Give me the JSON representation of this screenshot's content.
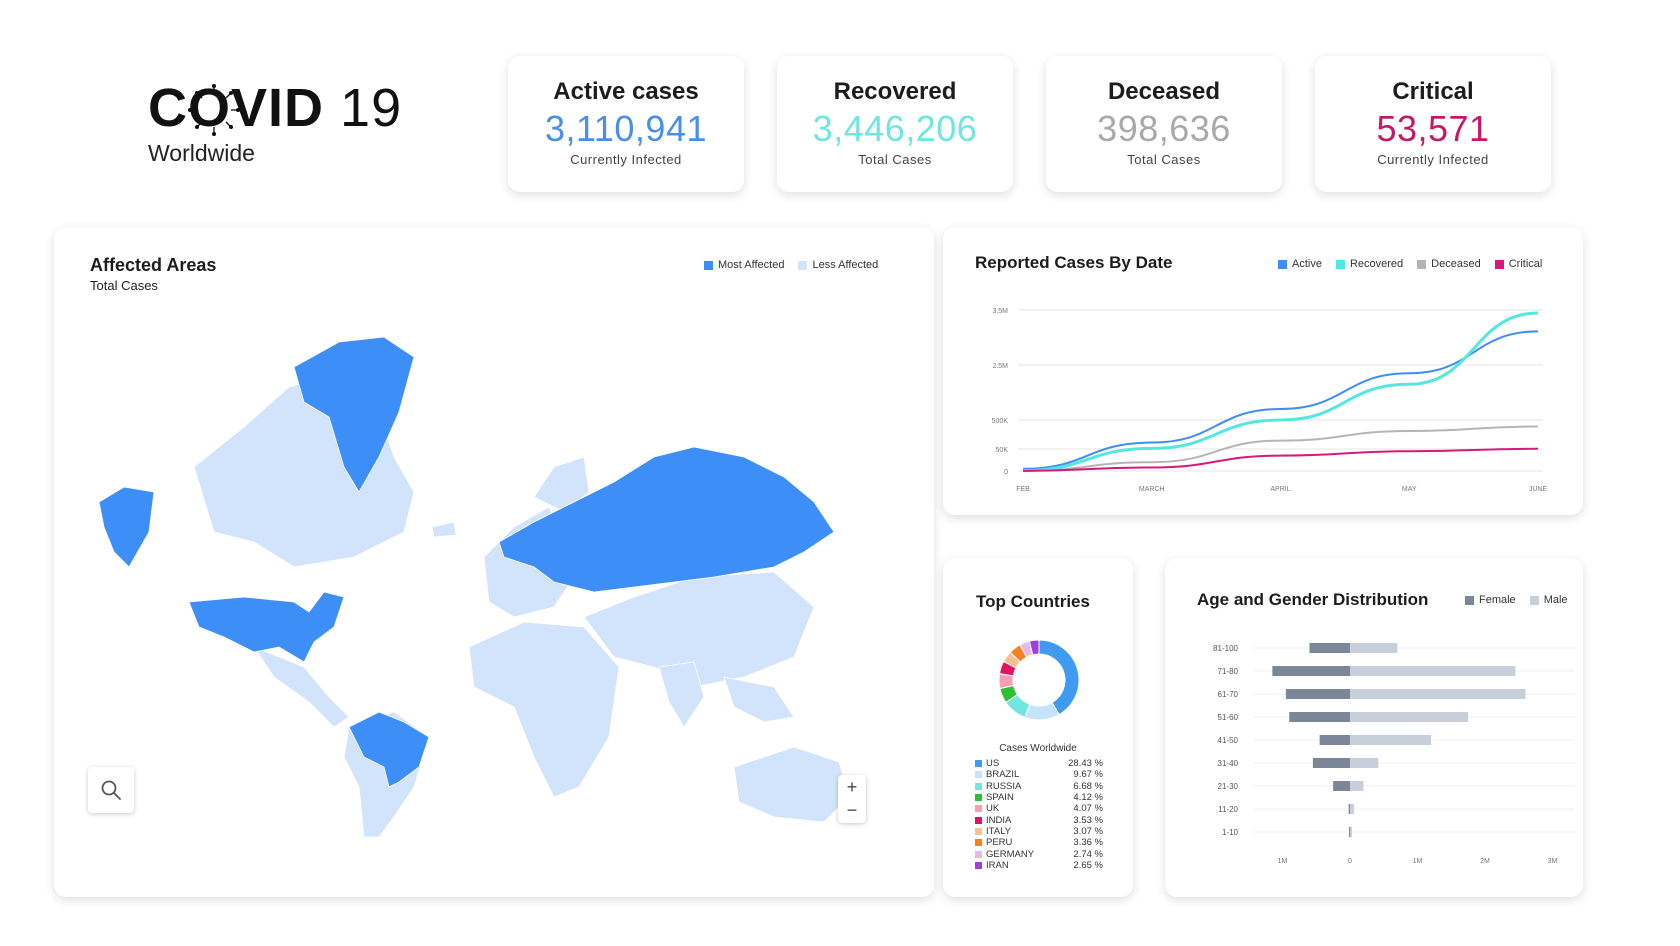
{
  "brand": {
    "title": "COVID",
    "title_num": "19",
    "subtitle": "Worldwide"
  },
  "stats": [
    {
      "label": "Active cases",
      "value": "3,110,941",
      "sub": "Currently Infected",
      "color": "#4a8fe7"
    },
    {
      "label": "Recovered",
      "value": "3,446,206",
      "sub": "Total Cases",
      "color": "#6fe6e0"
    },
    {
      "label": "Deceased",
      "value": "398,636",
      "sub": "Total Cases",
      "color": "#a9a9a9"
    },
    {
      "label": "Critical",
      "value": "53,571",
      "sub": "Currently Infected",
      "color": "#c2196b"
    }
  ],
  "affected_areas": {
    "title": "Affected Areas",
    "subtitle": "Total Cases",
    "legend": [
      {
        "label": "Most Affected",
        "color": "#3e8ef7"
      },
      {
        "label": "Less Affected",
        "color": "#d2e3fc"
      }
    ],
    "zoom_in": "+",
    "zoom_out": "−",
    "icons": {
      "search": "search-icon"
    }
  },
  "reported_cases": {
    "title": "Reported Cases By Date",
    "legend": [
      {
        "label": "Active",
        "color": "#3e8ef7"
      },
      {
        "label": "Recovered",
        "color": "#52e8e0"
      },
      {
        "label": "Deceased",
        "color": "#b5b5b5"
      },
      {
        "label": "Critical",
        "color": "#d6197a"
      }
    ]
  },
  "top_countries": {
    "title": "Top Countries",
    "caption": "Cases Worldwide",
    "countries": [
      {
        "name": "US",
        "pct": "28.43 %",
        "value": 28.43,
        "color": "#3e9bf0"
      },
      {
        "name": "BRAZIL",
        "pct": "9.67 %",
        "value": 9.67,
        "color": "#c5e3fc"
      },
      {
        "name": "RUSSIA",
        "pct": "6.68 %",
        "value": 6.68,
        "color": "#6fe6e0"
      },
      {
        "name": "SPAIN",
        "pct": "4.12 %",
        "value": 4.12,
        "color": "#2ebf34"
      },
      {
        "name": "UK",
        "pct": "4.07 %",
        "value": 4.07,
        "color": "#f2a0b4"
      },
      {
        "name": "INDIA",
        "pct": "3.53 %",
        "value": 3.53,
        "color": "#e3135f"
      },
      {
        "name": "ITALY",
        "pct": "3.07 %",
        "value": 3.07,
        "color": "#f5c28f"
      },
      {
        "name": "PERU",
        "pct": "3.36 %",
        "value": 3.36,
        "color": "#f58220"
      },
      {
        "name": "GERMANY",
        "pct": "2.74 %",
        "value": 2.74,
        "color": "#e9b9e6"
      },
      {
        "name": "IRAN",
        "pct": "2.65 %",
        "value": 2.65,
        "color": "#9b3fe0"
      }
    ]
  },
  "age_gender": {
    "title": "Age and Gender Distribution",
    "legend": [
      {
        "label": "Female",
        "color": "#7b8699"
      },
      {
        "label": "Male",
        "color": "#c8cfdb"
      }
    ]
  },
  "chart_data": [
    {
      "type": "line",
      "title": "Reported Cases By Date",
      "x": [
        "FEB",
        "MARCH",
        "APRIL",
        "MAY",
        "JUNE"
      ],
      "y_ticks": [
        "3.5M",
        "2.5M",
        "500K",
        "50K",
        "0"
      ],
      "series": [
        {
          "name": "Active",
          "values": [
            5000,
            150000,
            900000,
            2200000,
            3110941
          ]
        },
        {
          "name": "Recovered",
          "values": [
            1000,
            60000,
            500000,
            1800000,
            3446206
          ]
        },
        {
          "name": "Deceased",
          "values": [
            500,
            20000,
            180000,
            330000,
            398636
          ]
        },
        {
          "name": "Critical",
          "values": [
            300,
            8000,
            35000,
            45000,
            53571
          ]
        }
      ]
    },
    {
      "type": "pie",
      "title": "Top Countries",
      "categories": [
        "US",
        "BRAZIL",
        "RUSSIA",
        "SPAIN",
        "UK",
        "INDIA",
        "ITALY",
        "PERU",
        "GERMANY",
        "IRAN"
      ],
      "values": [
        28.43,
        9.67,
        6.68,
        4.12,
        4.07,
        3.53,
        3.07,
        3.36,
        2.74,
        2.65
      ]
    },
    {
      "type": "bar",
      "title": "Age and Gender Distribution",
      "categories": [
        "81-100",
        "71-80",
        "61-70",
        "51-60",
        "41-50",
        "31-40",
        "21-30",
        "11-20",
        "1-10"
      ],
      "series": [
        {
          "name": "Female",
          "values": [
            0.6,
            1.15,
            0.95,
            0.9,
            0.45,
            0.55,
            0.25,
            0.02,
            0.01
          ]
        },
        {
          "name": "Male",
          "values": [
            0.7,
            2.45,
            2.6,
            1.75,
            1.2,
            0.42,
            0.2,
            0.06,
            0.03
          ]
        }
      ],
      "x_ticks": [
        "1M",
        "0",
        "1M",
        "2M",
        "3M"
      ],
      "xlim": [
        -1,
        3
      ]
    }
  ]
}
